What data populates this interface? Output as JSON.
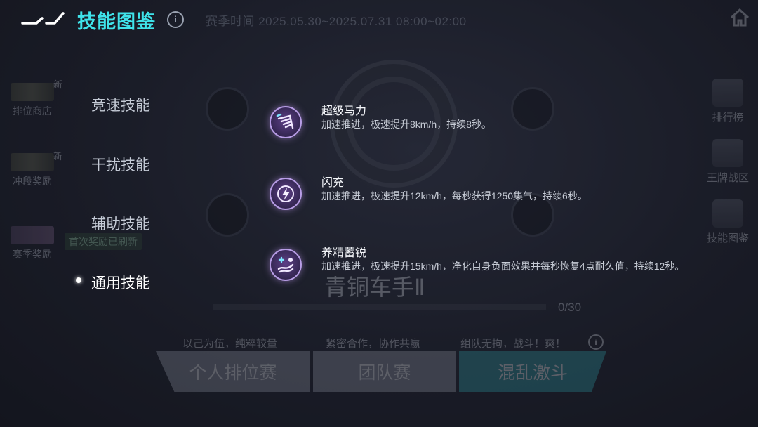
{
  "header": {
    "title": "技能图鉴",
    "info_symbol": "i"
  },
  "background": {
    "season_time": "赛季时间 2025.05.30~2025.07.31 08:00~02:00",
    "left_nav": [
      {
        "label": "排位商店",
        "badge": "新"
      },
      {
        "label": "冲段奖励",
        "badge": "新"
      },
      {
        "label": "赛季奖励",
        "badge": "首次奖励已刷新"
      }
    ],
    "right_nav": [
      {
        "label": "排行榜"
      },
      {
        "label": "王牌战区"
      },
      {
        "label": "技能图鉴"
      }
    ],
    "rank_name": "青铜车手Ⅱ",
    "progress_text": "0/30",
    "progress_fraction": 0.0,
    "mode_descriptions": [
      "以己为伍，纯粹较量",
      "紧密合作，协作共赢",
      "组队无拘，战斗！爽！"
    ],
    "modes": [
      "个人排位赛",
      "团队赛",
      "混乱激斗"
    ],
    "selected_mode": "混乱激斗"
  },
  "categories": [
    {
      "label": "竞速技能",
      "active": false
    },
    {
      "label": "干扰技能",
      "active": false
    },
    {
      "label": "辅助技能",
      "active": false
    },
    {
      "label": "通用技能",
      "active": true
    }
  ],
  "skills": [
    {
      "name": "超级马力",
      "icon": "boost-icon",
      "description": "加速推进，极速提升8km/h，持续8秒。"
    },
    {
      "name": "闪充",
      "icon": "lightning-icon",
      "description": "加速推进，极速提升12km/h，每秒获得1250集气，持续6秒。"
    },
    {
      "name": "养精蓄锐",
      "icon": "heal-icon",
      "description": "加速推进，极速提升15km/h，净化自身负面效果并每秒恢复4点耐久值，持续12秒。"
    }
  ],
  "colors": {
    "title_accent": "#3fe3ea",
    "skill_icon_glow": "#b89de6",
    "selected_mode": "#2f9aa3"
  }
}
